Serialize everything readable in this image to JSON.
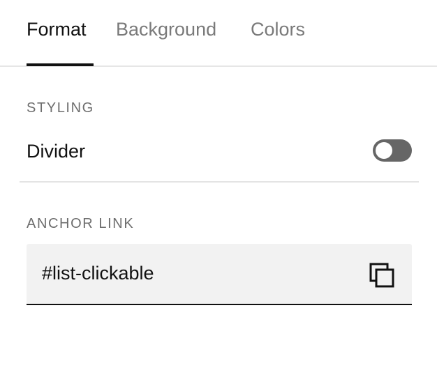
{
  "tabs": [
    {
      "label": "Format",
      "active": true
    },
    {
      "label": "Background",
      "active": false
    },
    {
      "label": "Colors",
      "active": false
    }
  ],
  "styling": {
    "heading": "STYLING",
    "divider_label": "Divider",
    "divider_enabled": false
  },
  "anchor": {
    "heading": "ANCHOR LINK",
    "value": "#list-clickable",
    "copy_icon": "copy-icon"
  },
  "colors": {
    "active_tab": "#111111",
    "inactive_tab": "#7a7a7a",
    "toggle_off": "#666666",
    "field_background": "#f2f2f2"
  }
}
